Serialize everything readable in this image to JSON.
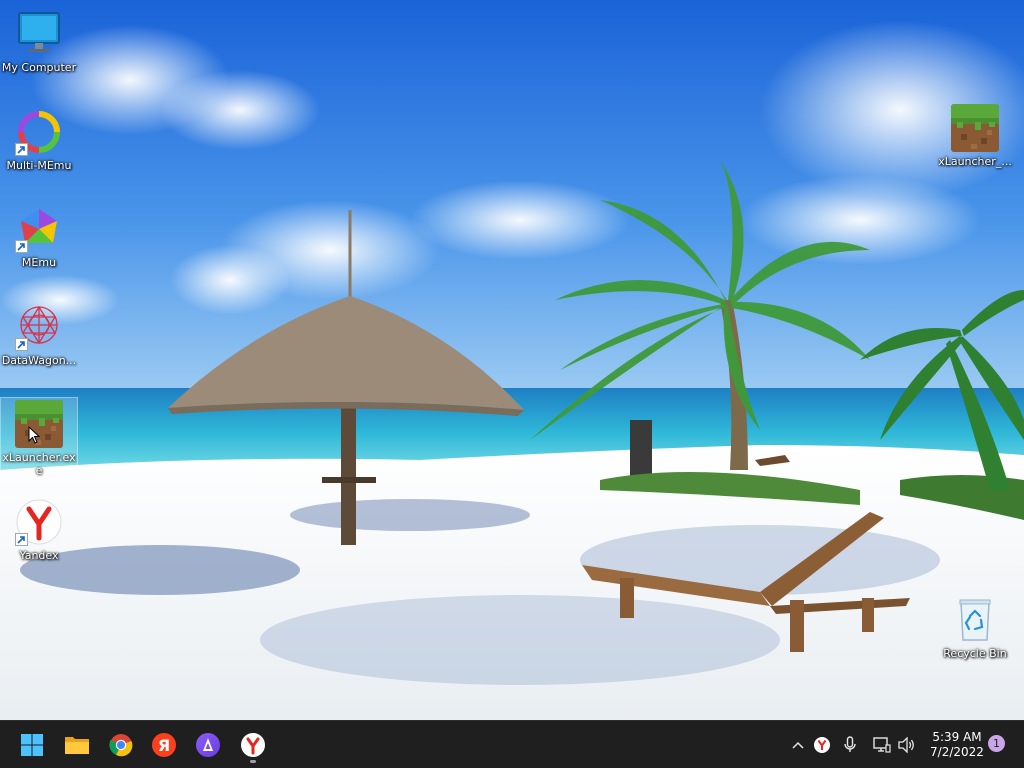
{
  "desktop": {
    "icons": [
      {
        "label": "My Computer",
        "icon": "monitor-icon"
      },
      {
        "label": "Multi-MEmu",
        "icon": "multi-memu-icon"
      },
      {
        "label": "MEmu",
        "icon": "memu-icon"
      },
      {
        "label": "DataWagon...",
        "icon": "datawagon-icon"
      },
      {
        "label": "xLauncher.exe",
        "icon": "minecraft-grass-block-icon"
      },
      {
        "label": "Yandex",
        "icon": "yandex-browser-icon"
      },
      {
        "label": "xLauncher_...",
        "icon": "minecraft-grass-block-icon"
      },
      {
        "label": "Recycle Bin",
        "icon": "recycle-bin-icon"
      }
    ]
  },
  "taskbar": {
    "pinned": [
      {
        "name": "Start",
        "icon": "windows-start-icon"
      },
      {
        "name": "File Explorer",
        "icon": "folder-icon"
      },
      {
        "name": "Google Chrome",
        "icon": "chrome-icon"
      },
      {
        "name": "Yandex",
        "icon": "yandex-ya-icon"
      },
      {
        "name": "Alice",
        "icon": "alice-assistant-icon"
      },
      {
        "name": "Yandex Browser",
        "icon": "yandex-browser-icon"
      }
    ],
    "tray": {
      "icons": [
        "chevron-up-icon",
        "yandex-tray-icon",
        "microphone-icon",
        "network-icon",
        "speaker-icon"
      ],
      "time": "5:39 AM",
      "date": "7/2/2022",
      "notification_count": "1"
    }
  },
  "colors": {
    "taskbar_bg": "#1f1f1f",
    "sky_top": "#1f6fe0",
    "sky_bottom": "#8fc3f2",
    "sea": "#2fb8d8",
    "sand": "#f4f6f8"
  }
}
